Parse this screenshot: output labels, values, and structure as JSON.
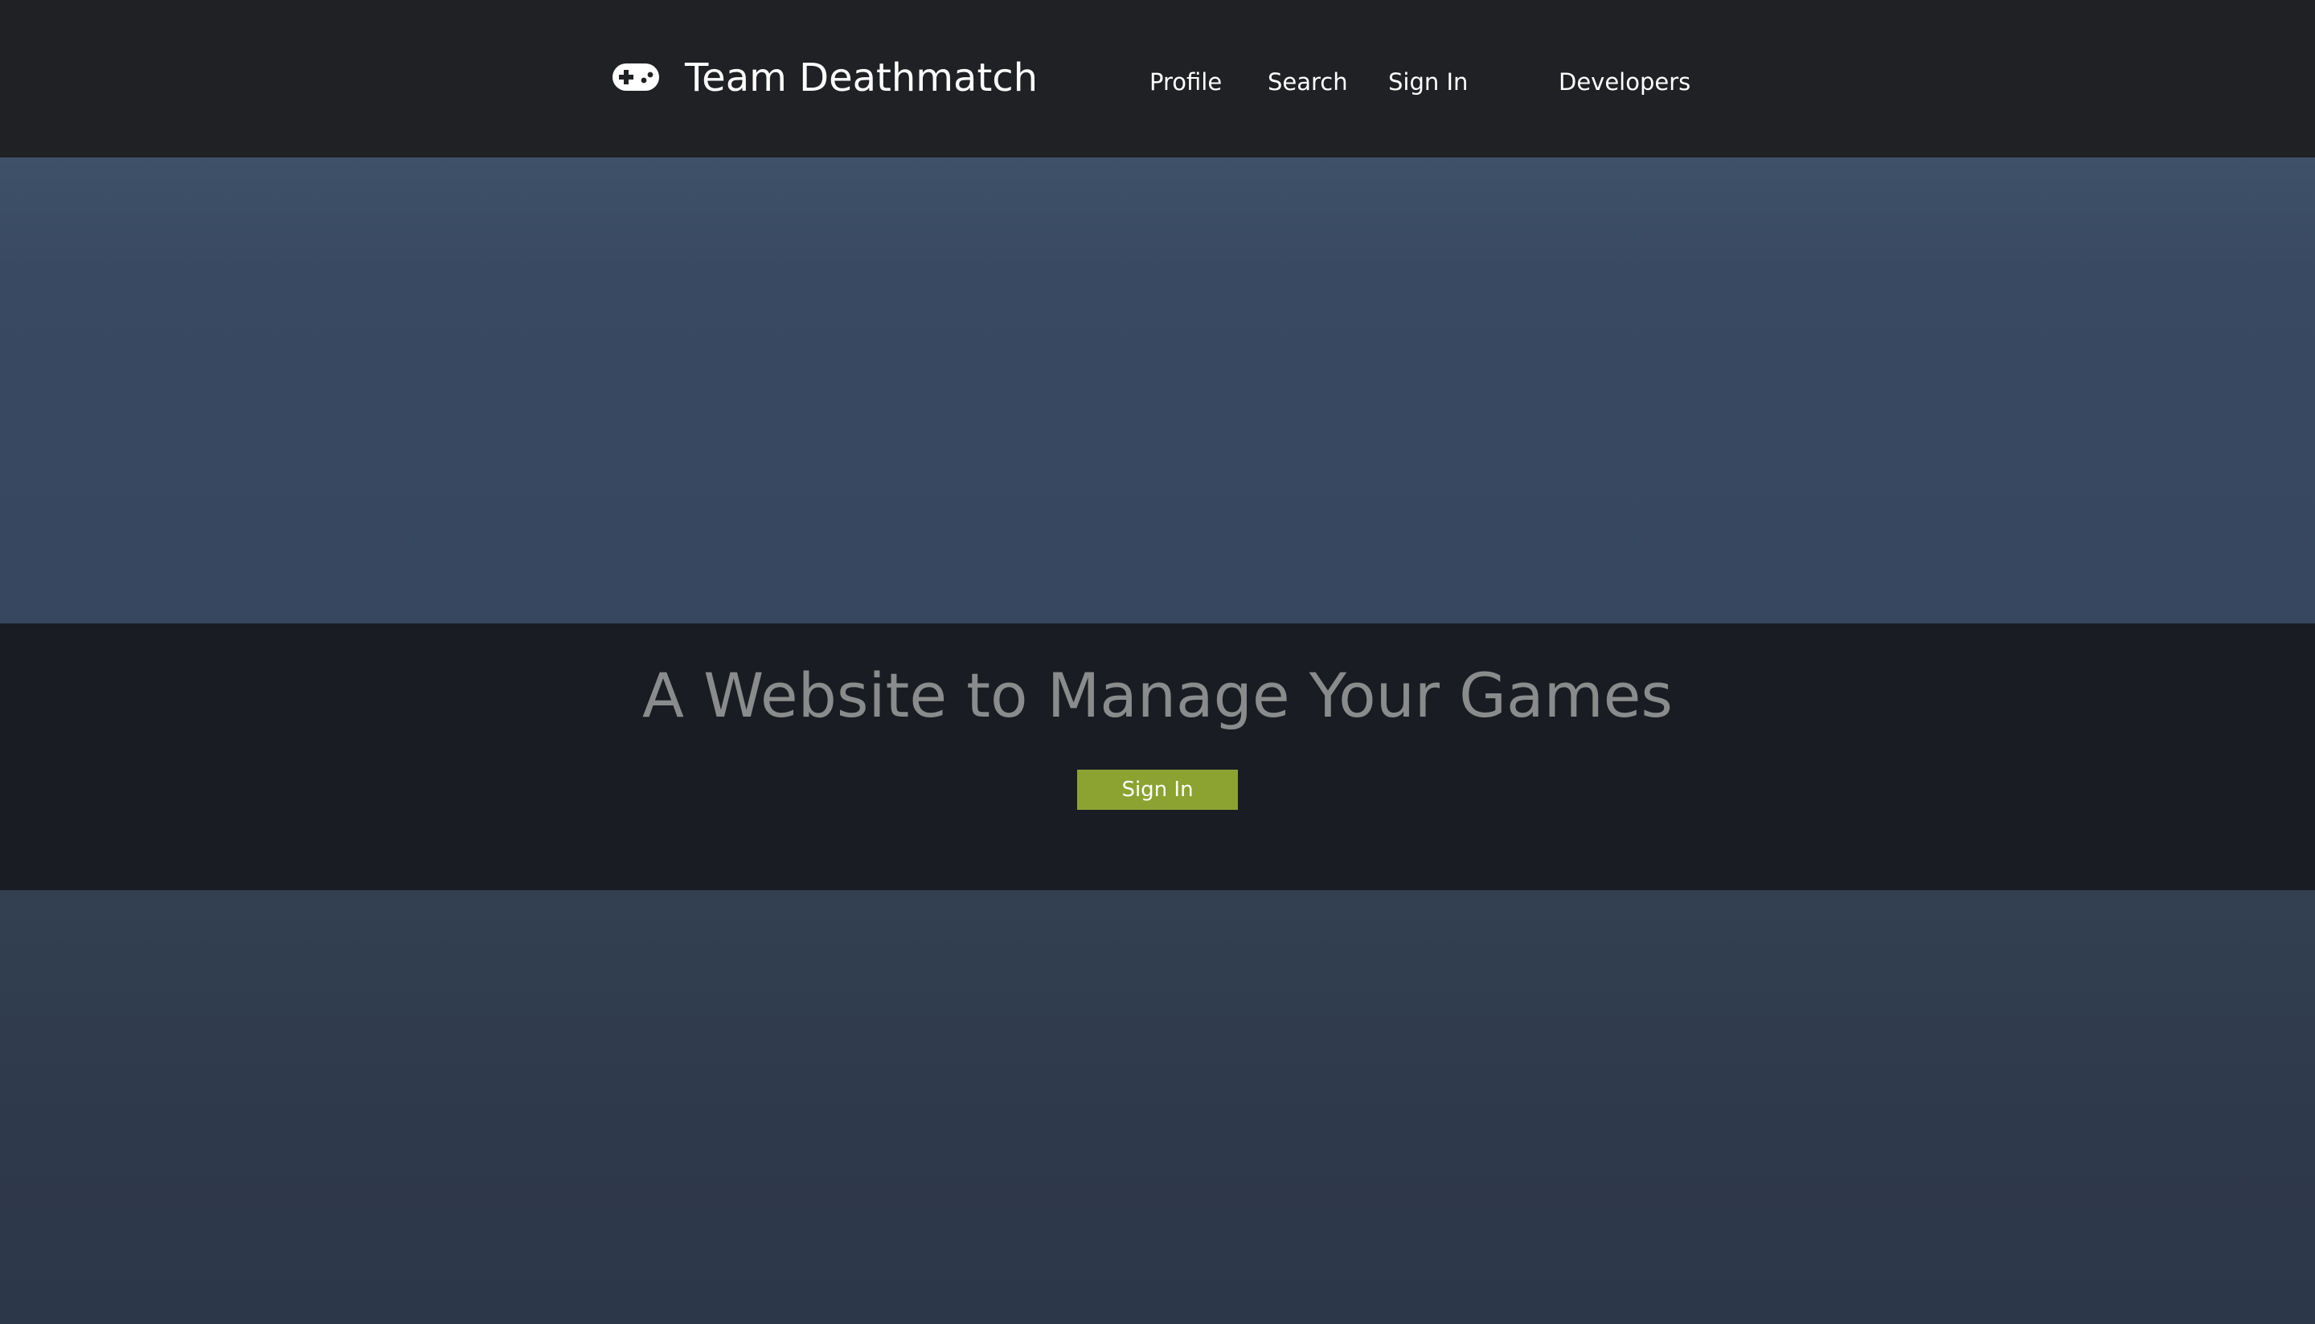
{
  "header": {
    "brand": {
      "icon": "gamepad-icon",
      "name": "Team Deathmatch"
    },
    "nav": [
      {
        "label": "Profile"
      },
      {
        "label": "Search"
      },
      {
        "label": "Sign In"
      },
      {
        "label": "Developers"
      }
    ]
  },
  "hero": {
    "tagline": "A Website to Manage Your Games",
    "cta_label": "Sign In"
  },
  "colors": {
    "header_bg": "#202124",
    "hero_bg": "#384961",
    "band_bg": "#191c23",
    "accent": "#8ca331",
    "tagline_text": "#8a8b8c"
  }
}
